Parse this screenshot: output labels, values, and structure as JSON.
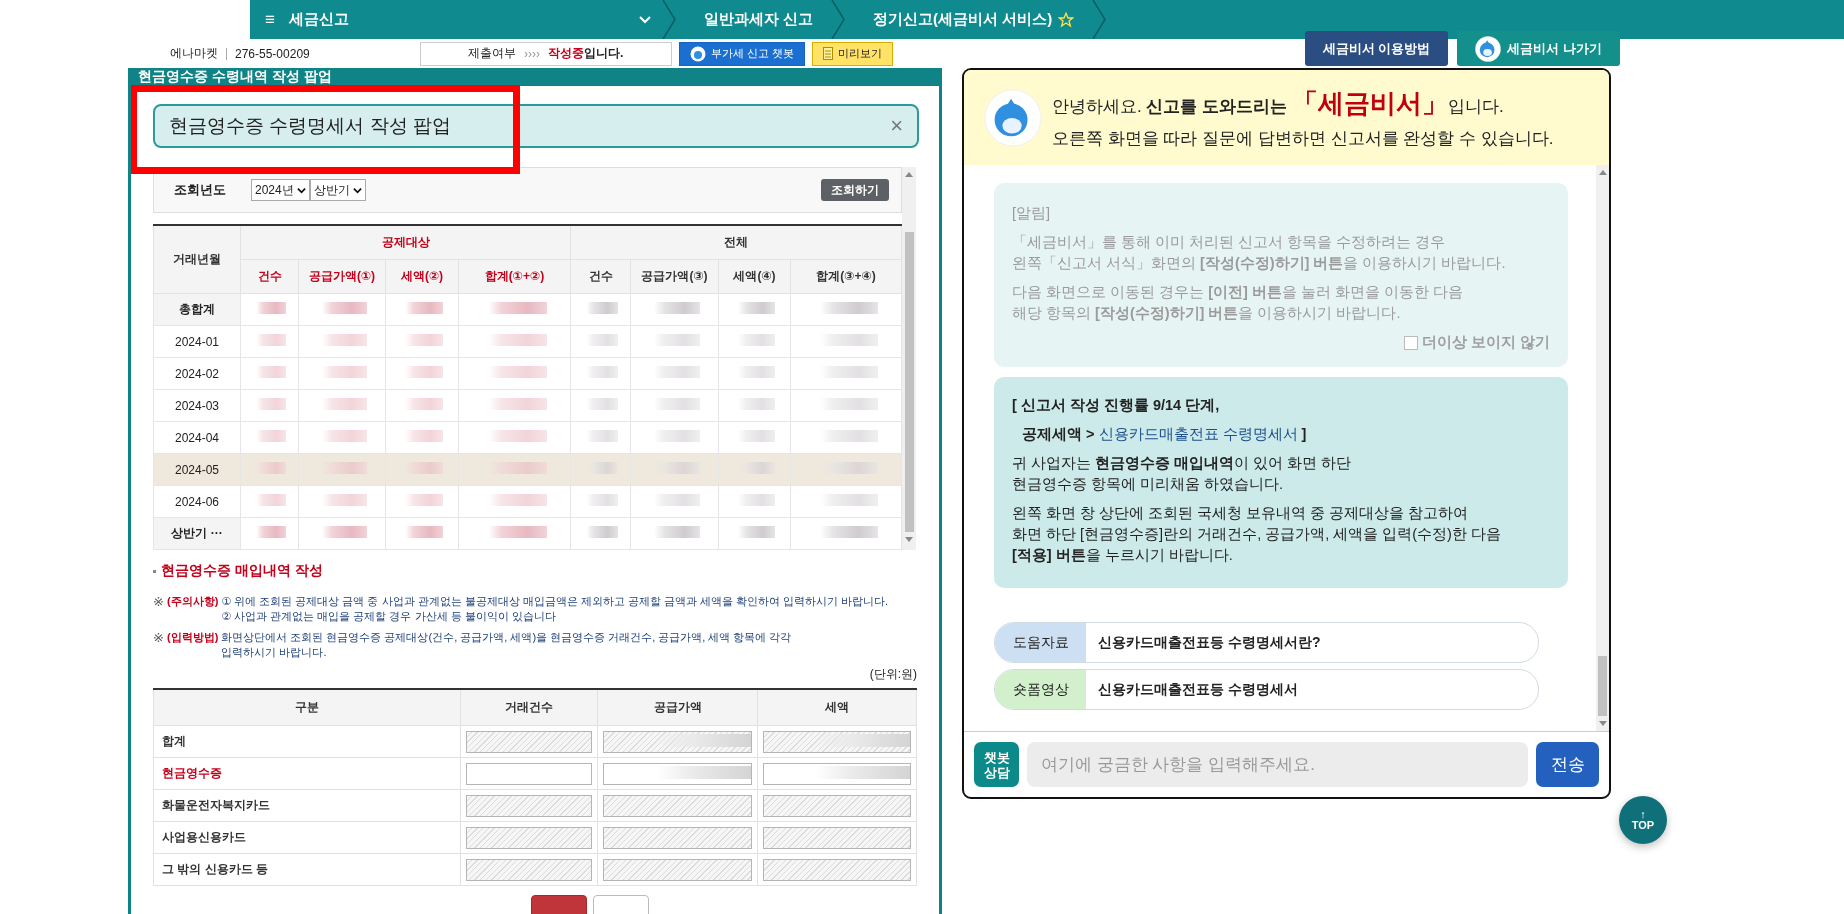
{
  "nav": {
    "menu_icon": "≡",
    "title": "세금신고",
    "crumbs": [
      {
        "label": "일반과세자 신고",
        "starred": false
      },
      {
        "label": "정기신고(세금비서 서비스)",
        "starred": true
      }
    ]
  },
  "info_bar": {
    "company": "에나마켓",
    "business_no": "276-55-00209",
    "status_label": "제출여부",
    "status_arrows": "››››",
    "status_value": "작성중",
    "status_suffix": "입니다.",
    "chatbot_button": "부가세 신고 챗봇",
    "preview_button": "미리보기"
  },
  "assistant_buttons": [
    {
      "label": "세금비서 이용방법",
      "kind": "plain"
    },
    {
      "label": "세금비서 나가기",
      "kind": "mascot"
    }
  ],
  "popup": {
    "header": "현금영수증 수령내역 작성 팝업",
    "title": "현금영수증 수령명세서 작성 팝업",
    "close": "×",
    "query": {
      "label": "조회년도",
      "year": "2024년",
      "half": "상반기",
      "button": "조회하기"
    },
    "table": {
      "row_header": "거래년월",
      "groups": [
        {
          "label": "공제대상",
          "kind": "deductible",
          "columns": [
            "건수",
            "공급가액(①)",
            "세액(②)",
            "합계(①+②)"
          ]
        },
        {
          "label": "전체",
          "kind": "all",
          "columns": [
            "건수",
            "공급가액(③)",
            "세액(④)",
            "합계(③+④)"
          ]
        }
      ],
      "rows": [
        {
          "label": "총합계",
          "kind": "total",
          "selected": false
        },
        {
          "label": "2024-01",
          "kind": "month",
          "selected": false
        },
        {
          "label": "2024-02",
          "kind": "month",
          "selected": false
        },
        {
          "label": "2024-03",
          "kind": "month",
          "selected": false
        },
        {
          "label": "2024-04",
          "kind": "month",
          "selected": false
        },
        {
          "label": "2024-05",
          "kind": "month",
          "selected": true
        },
        {
          "label": "2024-06",
          "kind": "month",
          "selected": false
        },
        {
          "label": "상반기 ···",
          "kind": "total",
          "selected": false
        }
      ]
    },
    "section_title": "현금영수증 매입내역 작성",
    "notes": [
      {
        "mark": "※",
        "label": "(주의사항)",
        "lines": [
          "① 위에 조회된 공제대상 금액 중 사업과 관계없는 불공제대상 매입금액은 제외하고 공제할 금액과 세액을 확인하여 입력하시기 바랍니다.",
          "② 사업과 관계없는 매입을 공제할 경우 가산세 등 불이익이 있습니다"
        ]
      },
      {
        "mark": "※",
        "label": "(입력방법)",
        "lines": [
          "화면상단에서 조회된 현금영수증 공제대상(건수, 공급가액, 세액)을 현금영수증 거래건수, 공급가액,  세액 항목에 각각 입력하시기 바랍니다."
        ]
      }
    ],
    "unit": "(단위:원)",
    "entry_columns": [
      "구분",
      "거래건수",
      "공급가액",
      "세액"
    ],
    "entry_rows": [
      {
        "label": "합계",
        "editable": false,
        "redacted": true
      },
      {
        "label": "현금영수증",
        "editable": true,
        "redacted": true
      },
      {
        "label": "화물운전자복지카드",
        "editable": false,
        "redacted": false
      },
      {
        "label": "사업용신용카드",
        "editable": false,
        "redacted": false
      },
      {
        "label": "그 밖의 신용카드 등",
        "editable": false,
        "redacted": false
      }
    ],
    "footer_buttons": [
      {
        "kind": "primary"
      },
      {
        "kind": "secondary"
      }
    ]
  },
  "assistant": {
    "greeting_before": "안녕하세요. **신고를 도와드리는**",
    "greeting_name": "「세금비서」",
    "greeting_after": "입니다.",
    "subtitle": "오른쪽 화면을 따라 질문에 답변하면 신고서를 완성할 수 있습니다.",
    "notice": {
      "title": "[알림]",
      "paragraphs": [
        "「세금비서」를 통해 이미 처리된 신고서 항목을 수정하려는 경우\n왼쪽「신고서 서식」화면의 **[작성(수정)하기] 버튼**을 이용하시기 바랍니다.",
        "다음 화면으로 이동된 경우는 **[이전] 버튼**을 눌러 화면을 이동한 다음\n해당 항목의 **[작성(수정)하기] 버튼**을 이용하시기 바랍니다."
      ],
      "dismiss": {
        "label": "더이상 보이지 않기",
        "checked": false
      }
    },
    "progress": {
      "title": "[ 신고서 작성 진행률 9/14 단계,",
      "path": "공제세액 >",
      "link": "신용카드매출전표 수령명세서",
      "end": "]",
      "paragraphs": [
        "귀 사업자는 **현금영수증 매입내역**이 있어 화면 하단\n현금영수증 항목에 미리채움 하였습니다.",
        "왼쪽 화면 창 상단에 조회된 국세청 보유내역 중 공제대상을 참고하여\n화면 하단 [현금영수증]란의 거래건수, 공급가액, 세액을 입력(수정)한 다음\n**[적용] 버튼**을 누르시기 바랍니다."
      ]
    },
    "links": [
      {
        "tag": "도움자료",
        "color": "#cddff2",
        "label": "신용카드매출전표등 수령명세서란?"
      },
      {
        "tag": "숏폼영상",
        "color": "#d3f0cc",
        "label": "신용카드매출전표등 수령명세서"
      }
    ],
    "chat_badge": "챗봇\n상담",
    "input_placeholder": "여기에 궁금한 사항을 입력해주세요.",
    "send_button": "전송"
  },
  "top_button": {
    "arrow": "↑",
    "label": "TOP"
  }
}
